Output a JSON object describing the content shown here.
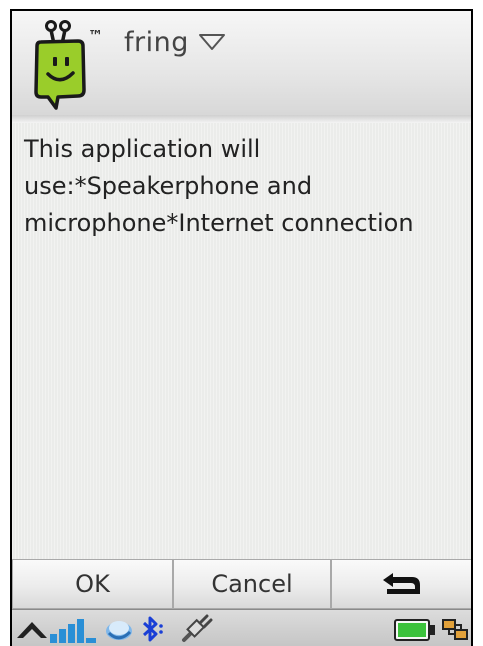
{
  "header": {
    "app_title": "fring",
    "logo_mark": "™",
    "logo_icon": "fring-logo-icon",
    "menu_icon": "chevron-down-icon"
  },
  "dialog": {
    "message": "This application will use:*Speakerphone and microphone*Internet connection"
  },
  "softkeys": {
    "ok_label": "OK",
    "cancel_label": "Cancel",
    "back_icon": "back-arrow-icon"
  },
  "statusbar": {
    "icons": [
      "up-arrow-icon",
      "signal-strength-icon",
      "network-globe-icon",
      "bluetooth-icon",
      "usb-icon",
      "battery-icon",
      "connection-icon"
    ]
  },
  "colors": {
    "logo_green": "#9acd2a",
    "background": "#ebecea",
    "signal_blue": "#2a8fd6"
  }
}
